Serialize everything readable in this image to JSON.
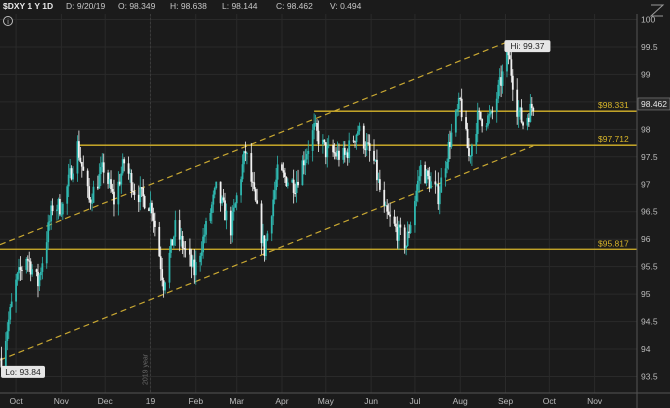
{
  "header": {
    "symbol": "$DXY 1 Y 1D",
    "date": "D: 9/20/19",
    "open": "O: 98.349",
    "high": "H: 98.638",
    "low": "L: 98.144",
    "close": "C: 98.462",
    "volume": "V: 0.494"
  },
  "colors": {
    "background": "#1b1b1b",
    "candle_up": "#2fb8b0",
    "candle_down": "#f2f2f2",
    "level_line": "#d9b62a",
    "channel_line": "#c9a832",
    "grid": "#2a2a2a"
  },
  "chart_data": {
    "type": "candlestick",
    "title": "",
    "xlabel": "",
    "ylabel": "",
    "ylim": [
      93.2,
      100.1
    ],
    "y_ticks": [
      "93.5",
      "94",
      "94.5",
      "95",
      "95.5",
      "96",
      "96.5",
      "97",
      "97.5",
      "98",
      "98.5",
      "99",
      "99.5",
      "100"
    ],
    "x_ticks": [
      "Oct",
      "Nov",
      "Dec",
      "19",
      "Feb",
      "Mar",
      "Apr",
      "May",
      "Jun",
      "Jul",
      "Aug",
      "Sep",
      "Oct",
      "Nov"
    ],
    "x_range": [
      "2018-09-20",
      "2019-11-30"
    ],
    "x_tick_dates": [
      "2018-10-01",
      "2018-11-01",
      "2018-12-01",
      "2019-01-01",
      "2019-02-01",
      "2019-03-01",
      "2019-04-01",
      "2019-05-01",
      "2019-06-01",
      "2019-07-01",
      "2019-08-01",
      "2019-09-01",
      "2019-10-01",
      "2019-11-01"
    ],
    "year_marker": {
      "label": "2019 year",
      "date": "2019-01-01"
    },
    "last_price": "98.462",
    "high_label": "Hi: 99.37",
    "high": {
      "date": "2019-09-03",
      "value": 99.37
    },
    "low_label": "Lo: 93.84",
    "low": {
      "date": "2018-09-21",
      "value": 93.84
    },
    "levels": [
      {
        "label": "$98.331",
        "value": 98.331,
        "start": "2019-04-23"
      },
      {
        "label": "$97.712",
        "value": 97.712,
        "start": "2018-11-12"
      },
      {
        "label": "$95.817",
        "value": 95.817,
        "start": "2018-09-20"
      }
    ],
    "channel": {
      "upper": [
        {
          "date": "2018-09-20",
          "value": 95.9
        },
        {
          "date": "2019-09-03",
          "value": 99.6
        }
      ],
      "lower": [
        {
          "date": "2018-09-20",
          "value": 93.8
        },
        {
          "date": "2019-09-20",
          "value": 97.7
        }
      ]
    },
    "series_anchors": [
      [
        "2018-09-21",
        93.84
      ],
      [
        "2018-10-01",
        95.2
      ],
      [
        "2018-10-08",
        95.7
      ],
      [
        "2018-10-16",
        95.2
      ],
      [
        "2018-10-26",
        96.6
      ],
      [
        "2018-11-02",
        96.6
      ],
      [
        "2018-11-12",
        97.7
      ],
      [
        "2018-11-20",
        96.7
      ],
      [
        "2018-11-30",
        97.3
      ],
      [
        "2018-12-07",
        96.7
      ],
      [
        "2018-12-14",
        97.4
      ],
      [
        "2018-12-21",
        96.9
      ],
      [
        "2019-01-02",
        96.6
      ],
      [
        "2019-01-10",
        95.2
      ],
      [
        "2019-01-18",
        96.2
      ],
      [
        "2019-01-31",
        95.4
      ],
      [
        "2019-02-15",
        96.9
      ],
      [
        "2019-02-25",
        96.2
      ],
      [
        "2019-03-07",
        97.6
      ],
      [
        "2019-03-20",
        95.8
      ],
      [
        "2019-03-29",
        97.2
      ],
      [
        "2019-04-10",
        97.0
      ],
      [
        "2019-04-23",
        98.0
      ],
      [
        "2019-05-01",
        97.6
      ],
      [
        "2019-05-14",
        97.5
      ],
      [
        "2019-05-23",
        98.0
      ],
      [
        "2019-06-03",
        97.4
      ],
      [
        "2019-06-10",
        96.5
      ],
      [
        "2019-06-25",
        95.9
      ],
      [
        "2019-07-05",
        97.3
      ],
      [
        "2019-07-17",
        96.8
      ],
      [
        "2019-07-25",
        97.8
      ],
      [
        "2019-08-01",
        98.5
      ],
      [
        "2019-08-07",
        97.5
      ],
      [
        "2019-08-13",
        98.2
      ],
      [
        "2019-08-22",
        98.2
      ],
      [
        "2019-09-03",
        99.37
      ],
      [
        "2019-09-09",
        98.4
      ],
      [
        "2019-09-13",
        98.1
      ],
      [
        "2019-09-20",
        98.46
      ]
    ]
  }
}
